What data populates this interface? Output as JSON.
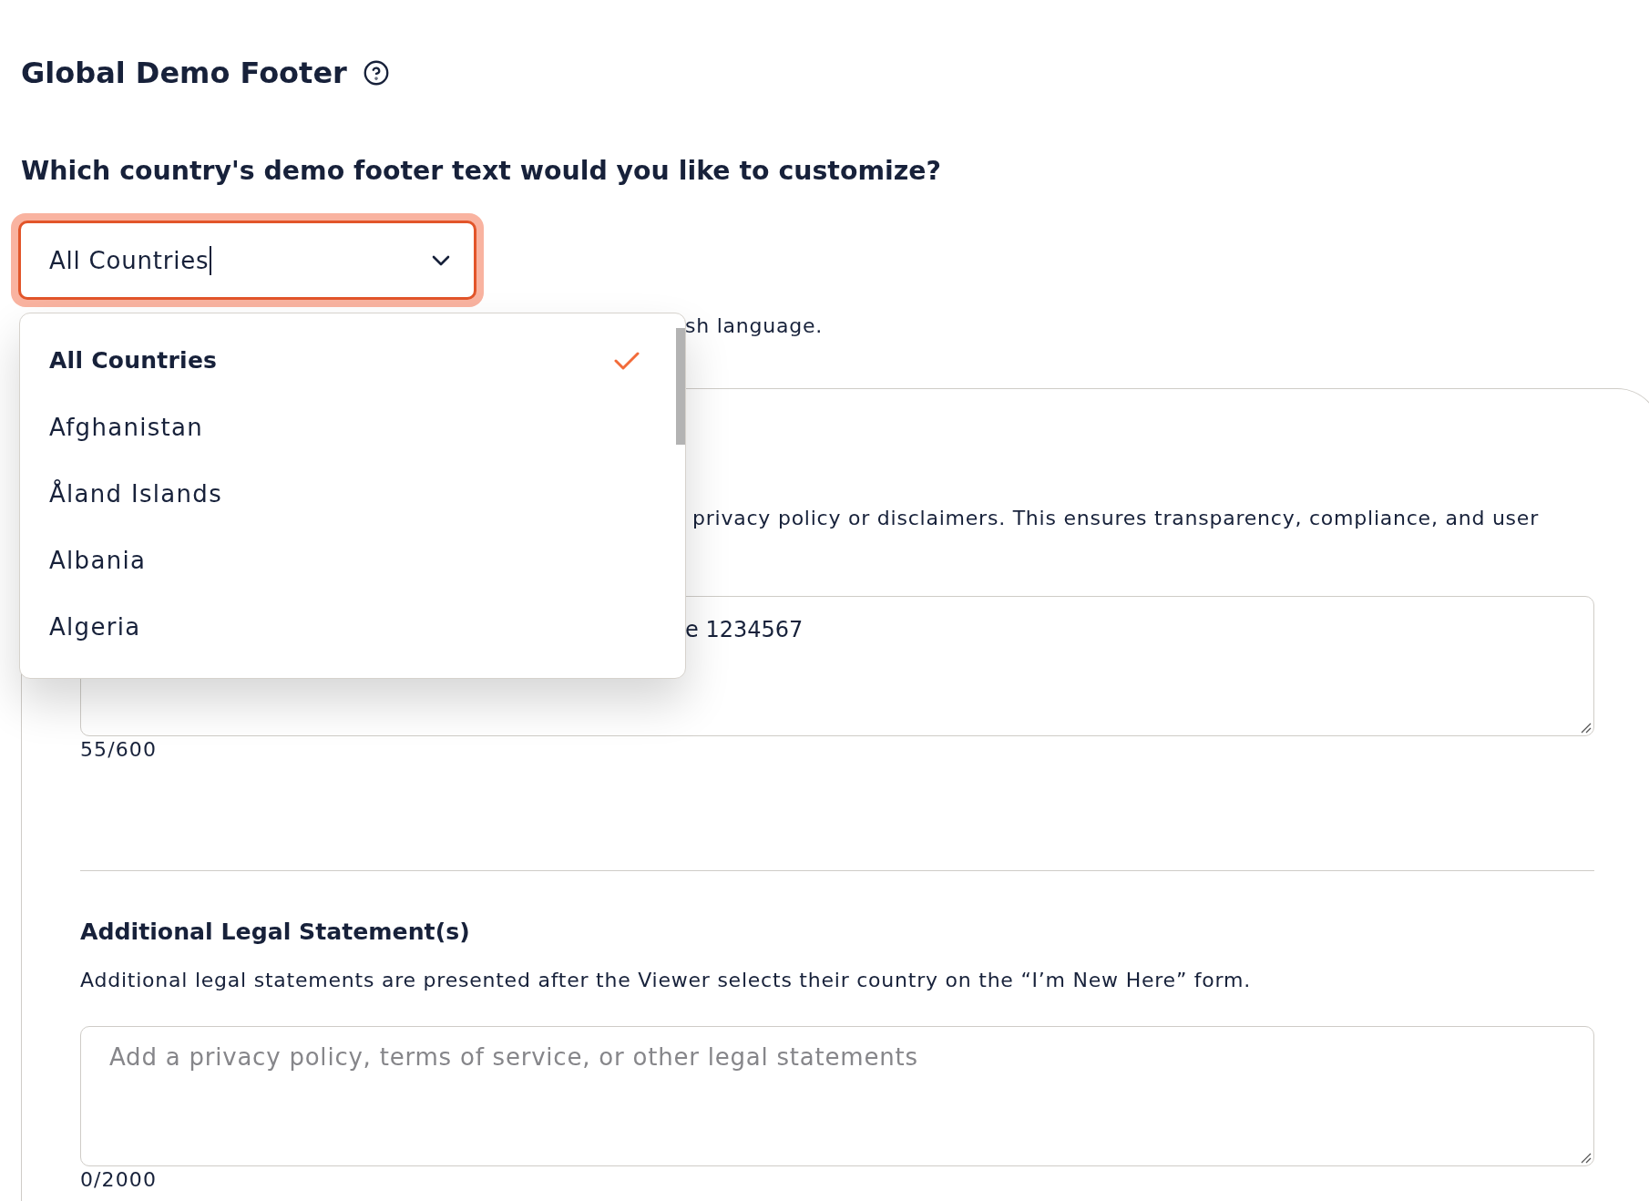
{
  "header": {
    "title": "Global Demo Footer"
  },
  "country_question": {
    "label": "Which country's demo footer text would you like to customize?"
  },
  "country_select": {
    "value": "All Countries",
    "focused": true,
    "expanded": true,
    "options": [
      {
        "label": "All Countries",
        "selected": true
      },
      {
        "label": "Afghanistan",
        "selected": false
      },
      {
        "label": "Åland Islands",
        "selected": false
      },
      {
        "label": "Albania",
        "selected": false
      },
      {
        "label": "Algeria",
        "selected": false
      }
    ]
  },
  "default_note": "sh language.",
  "footer_text": {
    "description": "privacy policy or disclaimers. This ensures transparency, compliance, and user",
    "value": "e 1234567",
    "counter": "55/600"
  },
  "legal": {
    "heading": "Additional Legal Statement(s)",
    "description": "Additional legal statements are presented after the Viewer selects their country on the “I’m New Here” form.",
    "placeholder": "Add a privacy policy, terms of service, or other legal statements",
    "counter": "0/2000"
  }
}
